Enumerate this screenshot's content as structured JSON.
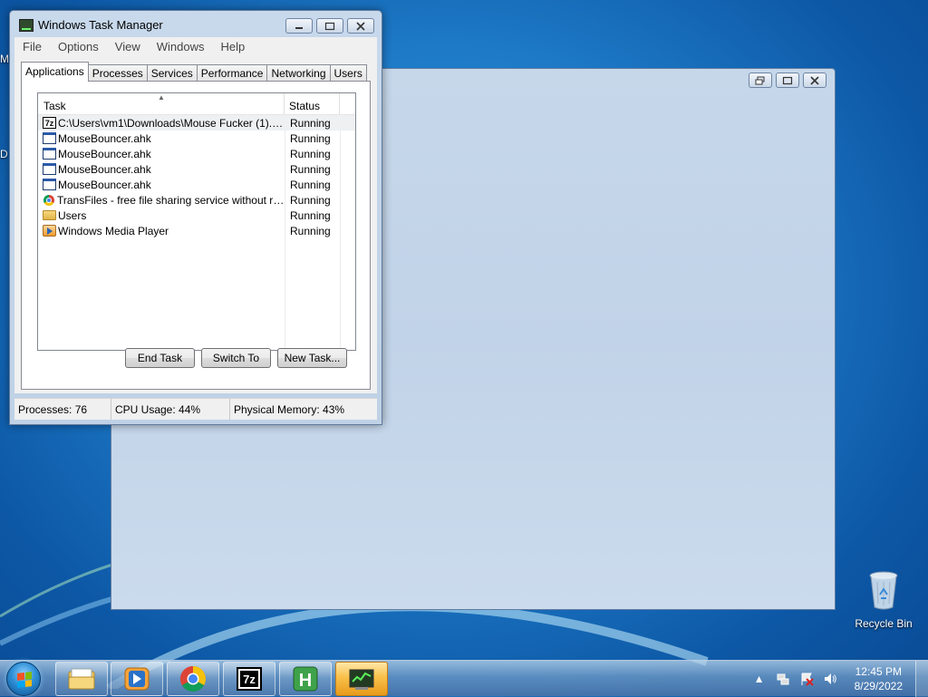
{
  "desktop": {
    "edge_labels": [
      "M",
      "D"
    ],
    "recycle_bin_label": "Recycle Bin"
  },
  "task_manager": {
    "title": "Windows Task Manager",
    "menu": [
      "File",
      "Options",
      "View",
      "Windows",
      "Help"
    ],
    "tabs": [
      "Applications",
      "Processes",
      "Services",
      "Performance",
      "Networking",
      "Users"
    ],
    "active_tab": "Applications",
    "columns": {
      "task": "Task",
      "status": "Status"
    },
    "tasks": [
      {
        "icon": "7zip-icon",
        "name": "C:\\Users\\vm1\\Downloads\\Mouse Fucker (1).zip\\",
        "status": "Running",
        "selected": true
      },
      {
        "icon": "window-icon",
        "name": "MouseBouncer.ahk",
        "status": "Running"
      },
      {
        "icon": "window-icon",
        "name": "MouseBouncer.ahk",
        "status": "Running"
      },
      {
        "icon": "window-icon",
        "name": "MouseBouncer.ahk",
        "status": "Running"
      },
      {
        "icon": "window-icon",
        "name": "MouseBouncer.ahk",
        "status": "Running"
      },
      {
        "icon": "chrome-icon",
        "name": "TransFiles - free file sharing service without regi...",
        "status": "Running"
      },
      {
        "icon": "folder-icon",
        "name": "Users",
        "status": "Running"
      },
      {
        "icon": "media-player-icon",
        "name": "Windows Media Player",
        "status": "Running"
      }
    ],
    "buttons": {
      "end_task": "End Task",
      "switch_to": "Switch To",
      "new_task": "New Task..."
    },
    "status": {
      "processes": "Processes: 76",
      "cpu": "CPU Usage: 44%",
      "memory": "Physical Memory: 43%"
    }
  },
  "taskbar": {
    "pinned": [
      "explorer-icon",
      "media-player-icon",
      "chrome-icon",
      "7zip-icon",
      "autohotkey-icon",
      "task-manager-icon"
    ],
    "active": "task-manager-icon",
    "clock": {
      "time": "12:45 PM",
      "date": "8/29/2022"
    }
  },
  "colors": {
    "taskbar_active": "#f9c04a",
    "window_frame": "#c8d9ec",
    "desktop": "#1f7cc9"
  }
}
